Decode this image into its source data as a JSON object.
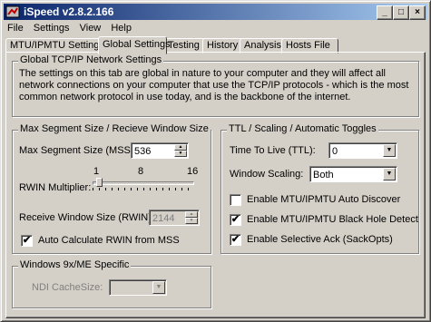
{
  "window": {
    "title": "iSpeed v2.8.2.166",
    "min": "_",
    "max": "□",
    "close": "×"
  },
  "menu": {
    "file": "File",
    "settings": "Settings",
    "view": "View",
    "help": "Help"
  },
  "tabs": [
    "MTU/IPMTU Setting",
    "Global Settings",
    "Testing",
    "History",
    "Analysis",
    "Hosts File"
  ],
  "active_tab": "Global Settings",
  "global_group": {
    "title": "Global TCP/IP Network Settings",
    "description": "The settings on this tab are global in nature to your computer and they will affect all network connections on your computer that use the TCP/IP protocols - which is the most common network protocol in use today, and is the backbone of the internet."
  },
  "mss_group": {
    "title": "Max Segment Size / Recieve Window Size",
    "mss_label": "Max Segment Size (MSS):",
    "mss_value": "536",
    "rwin_label": "RWIN Multiplier:",
    "rwin_scale": [
      "1",
      "8",
      "16"
    ],
    "rwin_multiplier": 2,
    "rwin_size_label": "Receive Window Size (RWIN):",
    "rwin_size_value": "2144",
    "auto_calc_label": "Auto Calculate RWIN from MSS",
    "auto_calc_checked": true
  },
  "ttl_group": {
    "title": "TTL / Scaling / Automatic Toggles",
    "ttl_label": "Time To Live (TTL):",
    "ttl_value": "0",
    "scaling_label": "Window Scaling:",
    "scaling_value": "Both",
    "auto_discover_label": "Enable MTU/IPMTU  Auto Discover",
    "auto_discover_checked": false,
    "black_hole_label": "Enable MTU/IPMTU Black Hole Detect",
    "black_hole_checked": true,
    "sack_label": "Enable Selective Ack (SackOpts)",
    "sack_checked": true
  },
  "win9x_group": {
    "title": "Windows 9x/ME Specific",
    "ndi_label": "NDI CacheSize:",
    "ndi_value": ""
  },
  "icons": {
    "app": "app-icon",
    "check": "✔"
  }
}
